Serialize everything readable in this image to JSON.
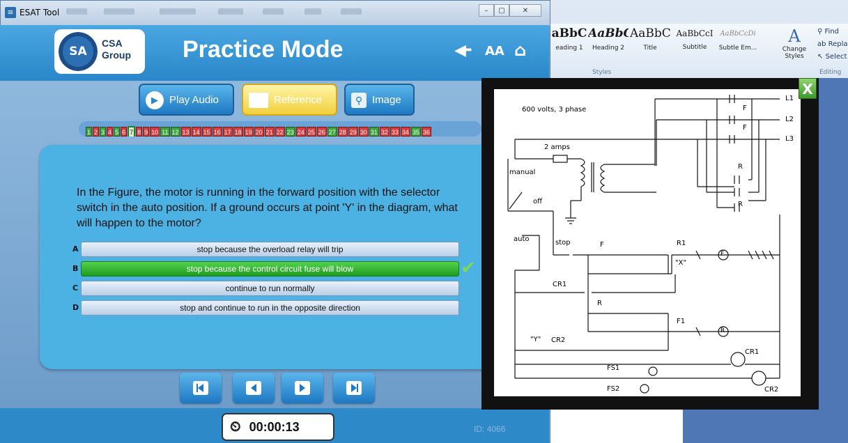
{
  "window": {
    "title": "ESAT Tool",
    "controls": [
      "–",
      "▢",
      "✕"
    ]
  },
  "header": {
    "logo_text_line1": "CSA",
    "logo_text_line2": "Group",
    "logo_seal": "SA",
    "mode_title": "Practice Mode",
    "text_size_label": "AA"
  },
  "toolbar": {
    "play_audio": "Play Audio",
    "reference": "Reference",
    "image": "Image"
  },
  "question_numbers": [
    {
      "n": "1",
      "s": "ok"
    },
    {
      "n": "2",
      "s": "bad"
    },
    {
      "n": "3",
      "s": "ok"
    },
    {
      "n": "4",
      "s": "bad"
    },
    {
      "n": "5",
      "s": "ok"
    },
    {
      "n": "6",
      "s": "bad"
    },
    {
      "n": "7",
      "s": "cur"
    },
    {
      "n": "8",
      "s": "bad"
    },
    {
      "n": "9",
      "s": "bad"
    },
    {
      "n": "10",
      "s": "bad"
    },
    {
      "n": "11",
      "s": "ok"
    },
    {
      "n": "12",
      "s": "ok"
    },
    {
      "n": "13",
      "s": "bad"
    },
    {
      "n": "14",
      "s": "bad"
    },
    {
      "n": "15",
      "s": "bad"
    },
    {
      "n": "16",
      "s": "bad"
    },
    {
      "n": "17",
      "s": "bad"
    },
    {
      "n": "18",
      "s": "bad"
    },
    {
      "n": "19",
      "s": "bad"
    },
    {
      "n": "20",
      "s": "bad"
    },
    {
      "n": "21",
      "s": "bad"
    },
    {
      "n": "22",
      "s": "bad"
    },
    {
      "n": "23",
      "s": "ok"
    },
    {
      "n": "24",
      "s": "bad"
    },
    {
      "n": "25",
      "s": "bad"
    },
    {
      "n": "26",
      "s": "bad"
    },
    {
      "n": "27",
      "s": "ok"
    },
    {
      "n": "28",
      "s": "bad"
    },
    {
      "n": "29",
      "s": "bad"
    },
    {
      "n": "30",
      "s": "bad"
    },
    {
      "n": "31",
      "s": "ok"
    },
    {
      "n": "32",
      "s": "bad"
    },
    {
      "n": "33",
      "s": "bad"
    },
    {
      "n": "34",
      "s": "bad"
    },
    {
      "n": "35",
      "s": "ok"
    },
    {
      "n": "36",
      "s": "bad"
    }
  ],
  "question": {
    "text": "In the Figure, the motor is running in the forward position with the selector switch in the auto position. If a ground occurs at point 'Y' in the diagram, what will happen to the motor?",
    "options": [
      {
        "letter": "A",
        "text": "stop because the overload relay will trip",
        "state": "normal"
      },
      {
        "letter": "B",
        "text": "stop because the control circuit fuse will blow",
        "state": "correct"
      },
      {
        "letter": "C",
        "text": "continue to run normally",
        "state": "normal"
      },
      {
        "letter": "D",
        "text": "stop and continue to run in the opposite direction",
        "state": "normal"
      }
    ],
    "correct_mark": "✔"
  },
  "timer": "00:00:13",
  "id_label": "ID: 4066",
  "popup": {
    "close": "X"
  },
  "diagram": {
    "supply": "600 volts, 3 phase",
    "fuse": "2 amps",
    "lines": [
      "L1",
      "L2",
      "L3"
    ],
    "labels": {
      "manual": "manual",
      "off": "off",
      "auto": "auto",
      "stop": "stop",
      "F": "F",
      "R": "R",
      "R1": "R1",
      "F1": "F1",
      "X": "\"X\"",
      "Y": "\"Y\"",
      "CR1": "CR1",
      "CR2": "CR2",
      "FS1": "FS1",
      "FS2": "FS2",
      "motor_F": "F",
      "motor_R": "R"
    }
  },
  "word": {
    "styles": [
      {
        "sample": "aBbC",
        "name": "eading 1"
      },
      {
        "sample": "AaBbC",
        "name": "Heading 2"
      },
      {
        "sample": "AaBbC",
        "name": "Title"
      },
      {
        "sample": "AaBbCcI",
        "name": "Subtitle"
      },
      {
        "sample": "AaBbCcDi",
        "name": "Subtle Em..."
      }
    ],
    "change_styles": "Change Styles",
    "group_styles": "Styles",
    "group_editing": "Editing",
    "find": "Find",
    "replace": "Repla",
    "select": "Select"
  },
  "colors": {
    "accent": "#2a86c8",
    "correct": "#1f9b1f",
    "wrong": "#d93a3a"
  }
}
